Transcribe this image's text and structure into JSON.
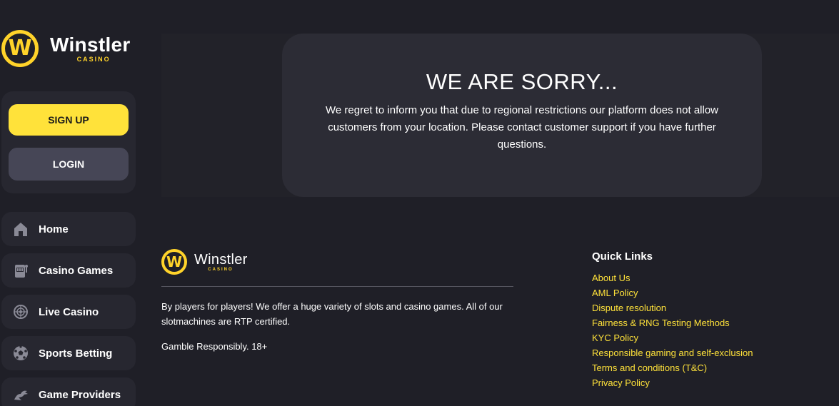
{
  "brand": {
    "name": "Winstler",
    "sub": "CASINO",
    "mark": "W",
    "accent": "#ffe23a"
  },
  "auth": {
    "signup_label": "SIGN UP",
    "login_label": "LOGIN"
  },
  "nav": {
    "items": [
      {
        "label": "Home",
        "icon": "home-icon"
      },
      {
        "label": "Casino Games",
        "icon": "slot-machine-icon"
      },
      {
        "label": "Live Casino",
        "icon": "roulette-icon"
      },
      {
        "label": "Sports Betting",
        "icon": "soccer-ball-icon"
      },
      {
        "label": "Game Providers",
        "icon": "dragon-icon"
      }
    ]
  },
  "sorry": {
    "title": "WE ARE SORRY...",
    "message": "We regret to inform you that due to regional restrictions our platform does not allow customers from your location. Please contact customer support if you have further questions."
  },
  "footer": {
    "description": "By players for players! We offer a huge variety of slots and casino games. All of our slotmachines are RTP certified.",
    "responsible": "Gamble Responsibly. 18+",
    "quick_links_title": "Quick Links",
    "quick_links": [
      "About Us",
      "AML Policy",
      "Dispute resolution",
      "Fairness & RNG Testing Methods",
      "KYC Policy",
      "Responsible gaming and self-exclusion",
      "Terms and conditions (T&C)",
      "Privacy Policy"
    ]
  }
}
